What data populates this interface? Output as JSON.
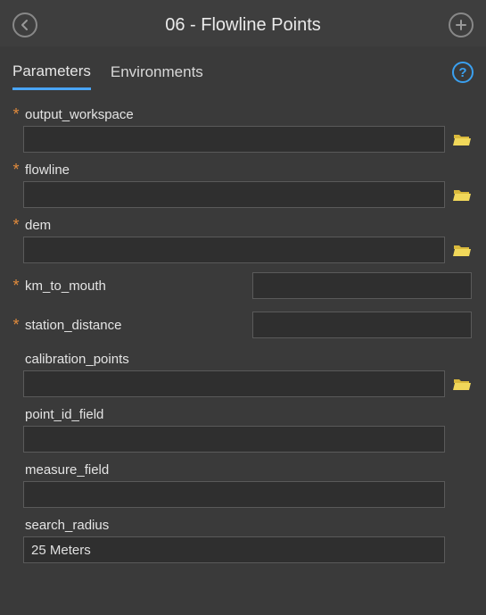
{
  "header": {
    "title": "06 - Flowline Points"
  },
  "tabs": {
    "parameters": "Parameters",
    "environments": "Environments"
  },
  "fields": {
    "output_workspace": {
      "label": "output_workspace",
      "value": ""
    },
    "flowline": {
      "label": "flowline",
      "value": ""
    },
    "dem": {
      "label": "dem",
      "value": ""
    },
    "km_to_mouth": {
      "label": "km_to_mouth",
      "value": ""
    },
    "station_distance": {
      "label": "station_distance",
      "value": ""
    },
    "calibration_points": {
      "label": "calibration_points",
      "value": ""
    },
    "point_id_field": {
      "label": "point_id_field",
      "value": ""
    },
    "measure_field": {
      "label": "measure_field",
      "value": ""
    },
    "search_radius": {
      "label": "search_radius",
      "value": "25 Meters"
    }
  }
}
